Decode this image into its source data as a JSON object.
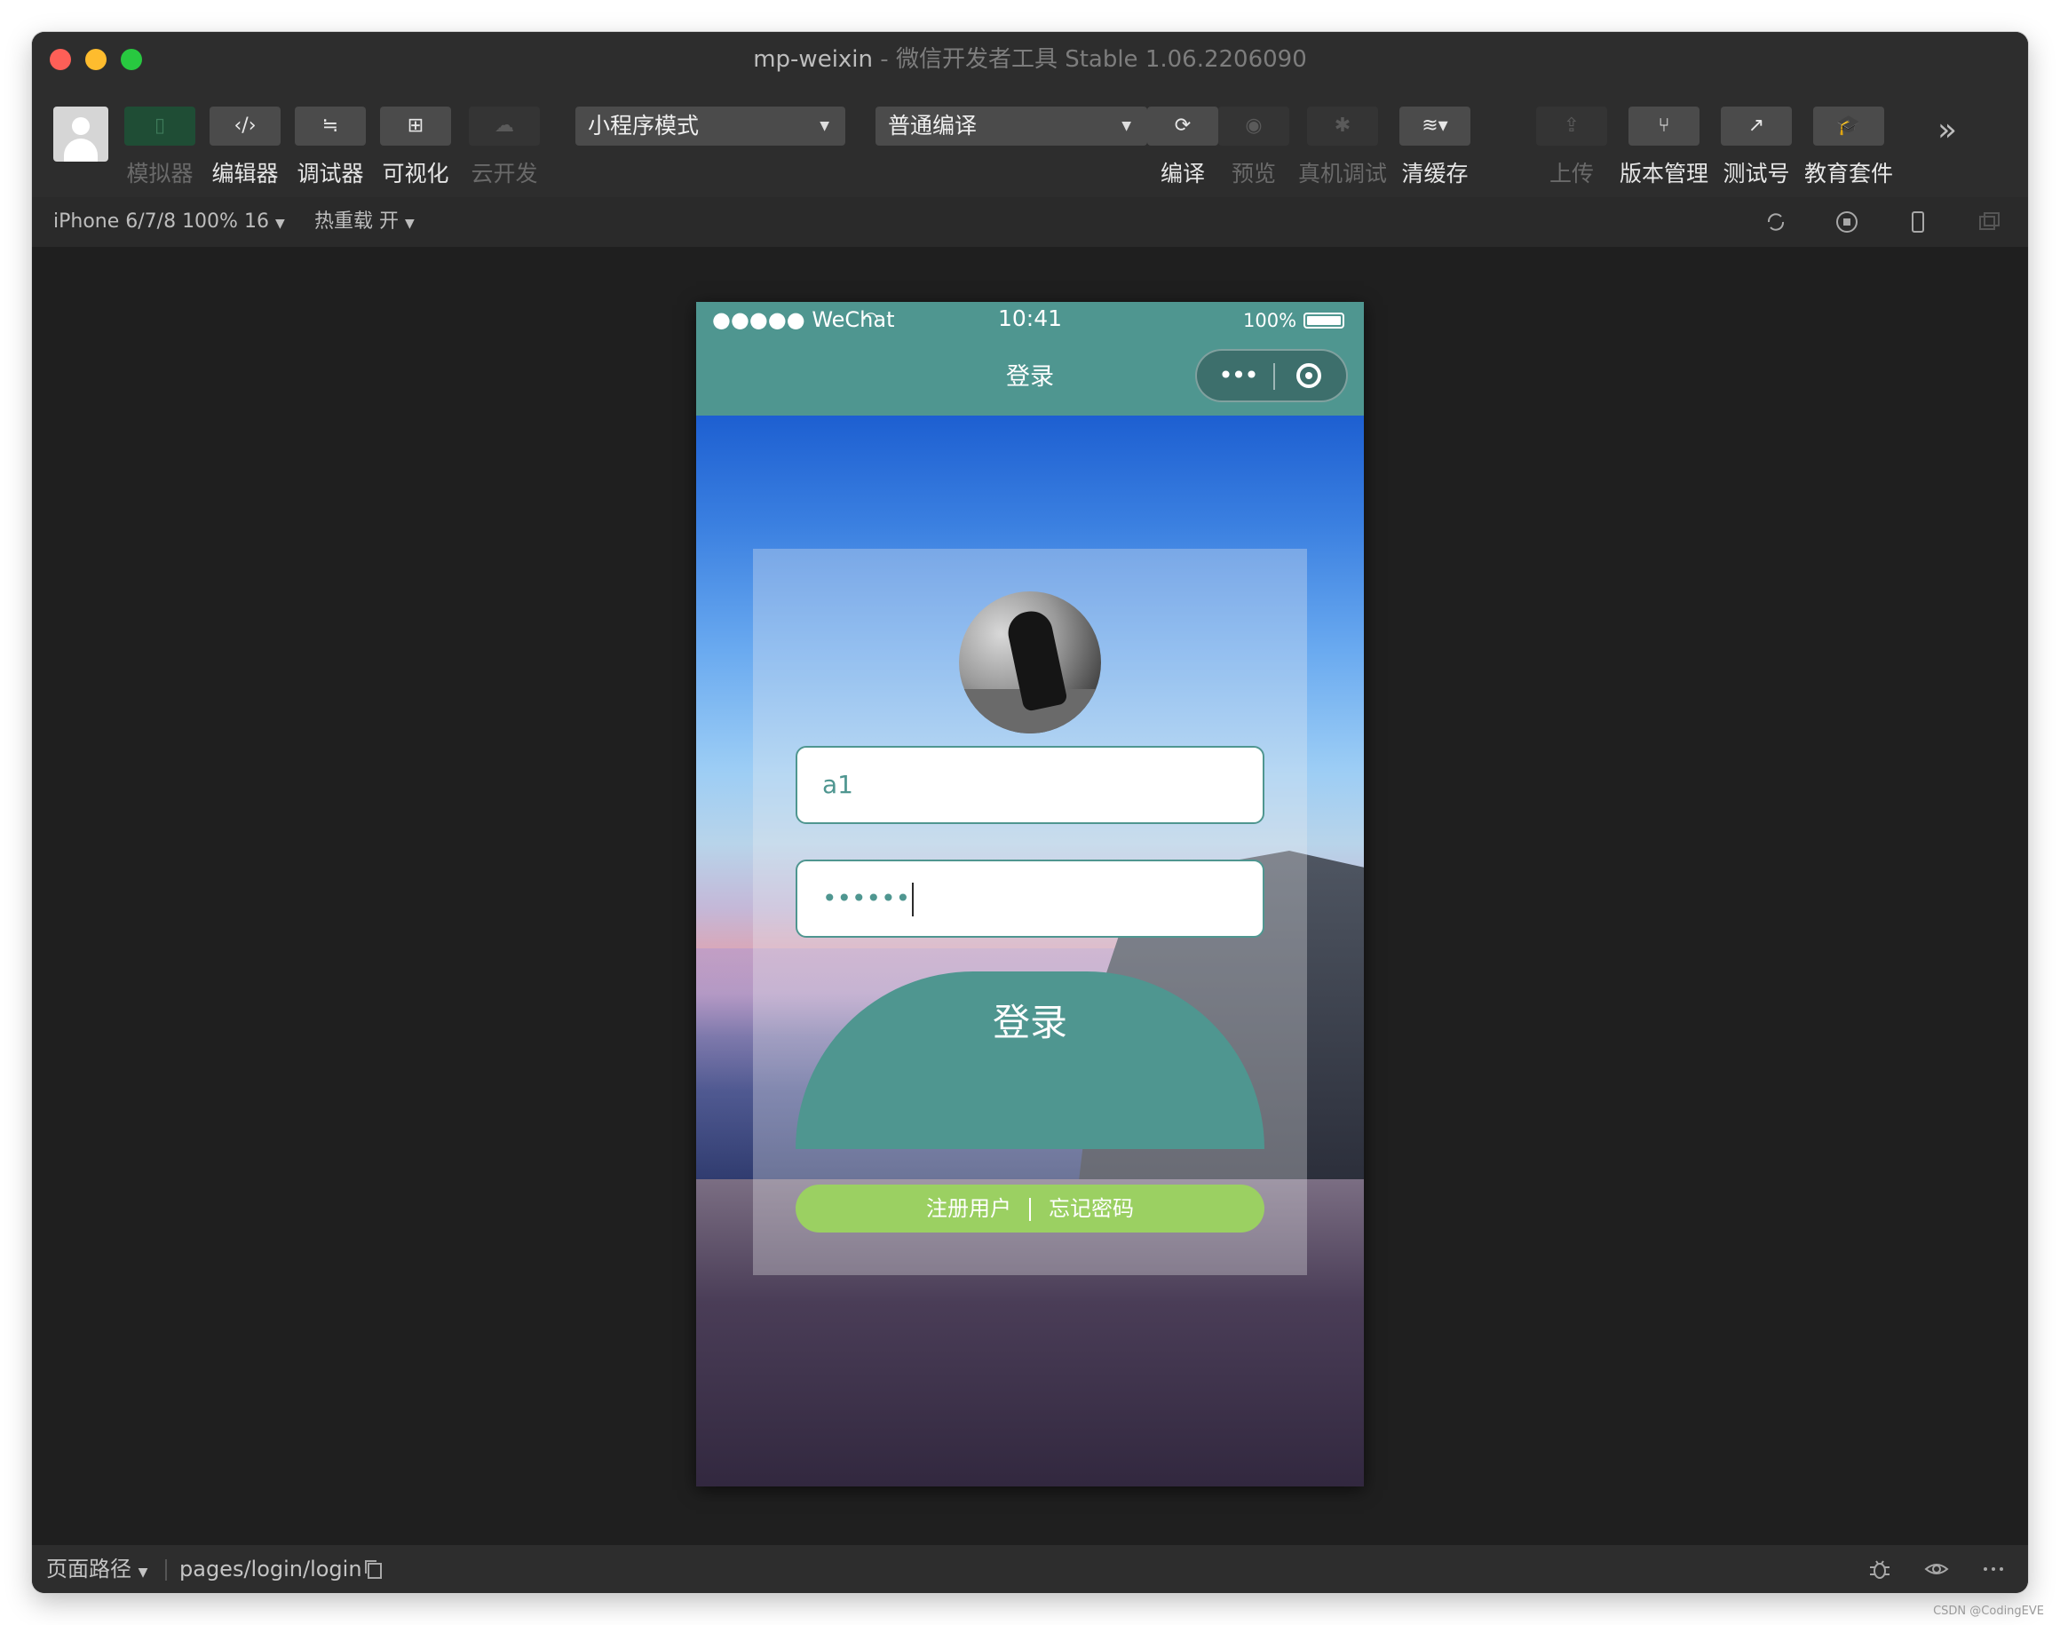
{
  "window": {
    "title_main": "mp-weixin",
    "title_sep": " - ",
    "title_sub": "微信开发者工具 Stable 1.06.2206090"
  },
  "toolbar": {
    "left_tools": [
      {
        "label": "模拟器",
        "icon": "phone-icon"
      },
      {
        "label": "编辑器",
        "icon": "code-icon"
      },
      {
        "label": "调试器",
        "icon": "sliders-icon"
      },
      {
        "label": "可视化",
        "icon": "layout-icon"
      },
      {
        "label": "云开发",
        "icon": "cloud-icon"
      }
    ],
    "mode_select": "小程序模式",
    "compile_select": "普通编译",
    "right_tools": [
      {
        "label": "编译",
        "icon": "refresh-icon"
      },
      {
        "label": "预览",
        "icon": "eye-icon"
      },
      {
        "label": "真机调试",
        "icon": "bug-icon"
      },
      {
        "label": "清缓存",
        "icon": "layers-icon"
      },
      {
        "label": "上传",
        "icon": "upload-icon"
      },
      {
        "label": "版本管理",
        "icon": "branch-icon"
      },
      {
        "label": "测试号",
        "icon": "external-link-icon"
      },
      {
        "label": "教育套件",
        "icon": "graduation-cap-icon"
      }
    ],
    "more_glyph": "»"
  },
  "subbar": {
    "device": "iPhone 6/7/8 100% 16",
    "hot_reload": "热重载 开"
  },
  "phone": {
    "carrier": "●●●●● WeChat",
    "time": "10:41",
    "battery": "100%",
    "nav_title": "登录",
    "capsule_dots": "•••",
    "username_value": "a1",
    "password_mask": "••••••",
    "login_button": "登录",
    "register_link": "注册用户",
    "forgot_link": "忘记密码"
  },
  "bottombar": {
    "path_label": "页面路径",
    "path_value": "pages/login/login"
  },
  "watermark": "CSDN @CodingEVE"
}
